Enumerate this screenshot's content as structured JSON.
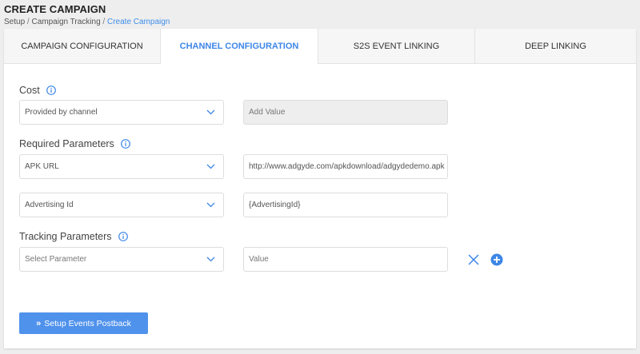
{
  "header": {
    "title": "CREATE CAMPAIGN",
    "breadcrumb": [
      "Setup",
      "Campaign Tracking",
      "Create Campaign"
    ],
    "breadcrumb_separator": " / "
  },
  "tabs": [
    {
      "label": "CAMPAIGN CONFIGURATION",
      "active": false
    },
    {
      "label": "CHANNEL CONFIGURATION",
      "active": true
    },
    {
      "label": "S2S EVENT LINKING",
      "active": false
    },
    {
      "label": "DEEP LINKING",
      "active": false
    }
  ],
  "cost": {
    "label": "Cost",
    "select_value": "Provided by channel",
    "input_placeholder": "Add Value"
  },
  "required_parameters": {
    "label": "Required Parameters",
    "rows": [
      {
        "select_value": "APK URL",
        "input_value": "http://www.adgyde.com/apkdownload/adgydedemo.apk"
      },
      {
        "select_value": "Advertising Id",
        "input_value": "{AdvertisingId}"
      }
    ]
  },
  "tracking_parameters": {
    "label": "Tracking Parameters",
    "select_placeholder": "Select Parameter",
    "input_placeholder": "Value"
  },
  "actions": {
    "setup_postback_label": "Setup Events Postback",
    "setup_postback_icon": "double-chevron-right-icon"
  },
  "colors": {
    "accent": "#3d86e6",
    "button": "#4f92ec",
    "disabled_field": "#eeeeee"
  },
  "icons": {
    "info": "info-icon",
    "dropdown": "chevron-down-icon",
    "remove": "close-icon",
    "add": "plus-circle-icon"
  }
}
